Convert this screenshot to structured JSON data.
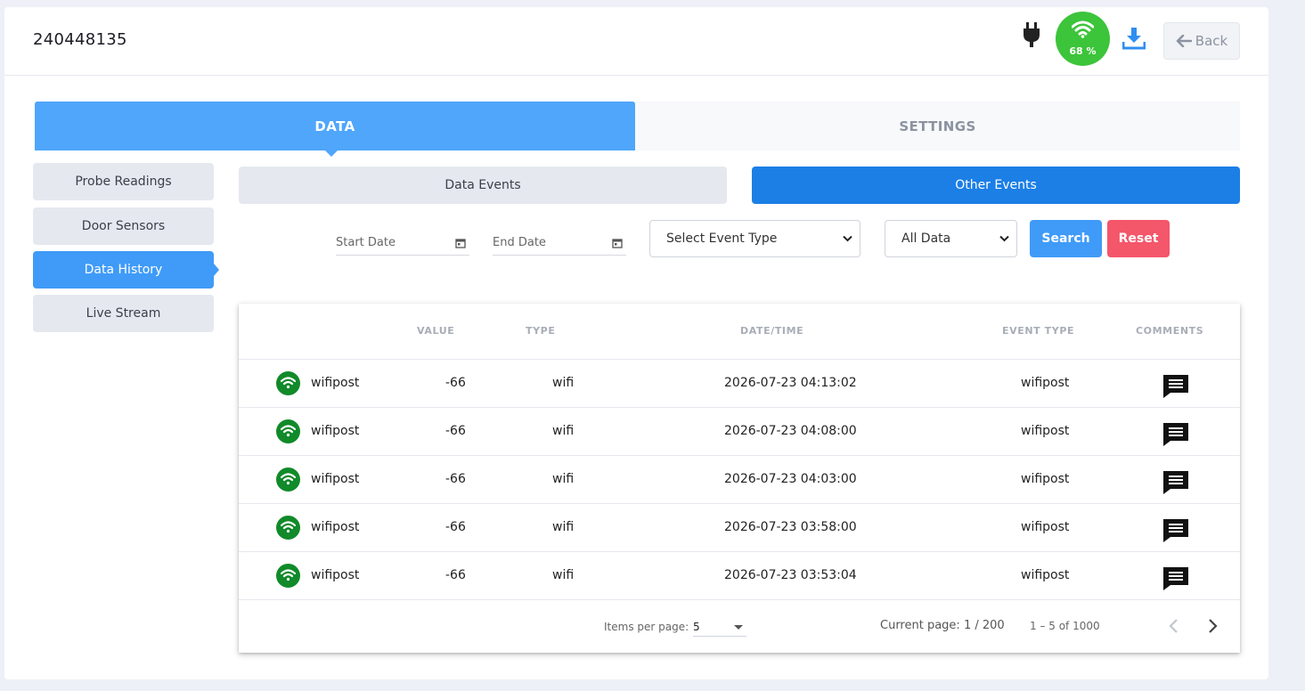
{
  "header": {
    "device_id": "240448135",
    "wifi_percent": "68 %",
    "back_label": "Back"
  },
  "main_tabs": [
    {
      "label": "DATA",
      "active": true
    },
    {
      "label": "SETTINGS",
      "active": false
    }
  ],
  "sidebar": {
    "items": [
      {
        "label": "Probe Readings",
        "active": false
      },
      {
        "label": "Door Sensors",
        "active": false
      },
      {
        "label": "Data History",
        "active": true
      },
      {
        "label": "Live Stream",
        "active": false
      }
    ]
  },
  "sub_tabs": [
    {
      "label": "Data Events",
      "active": false
    },
    {
      "label": "Other Events",
      "active": true
    }
  ],
  "filters": {
    "start_date_placeholder": "Start Date",
    "end_date_placeholder": "End Date",
    "event_type_selected": "Select Event Type",
    "data_filter_selected": "All Data",
    "search_label": "Search",
    "reset_label": "Reset"
  },
  "table": {
    "columns": [
      "VALUE",
      "TYPE",
      "DATE/TIME",
      "EVENT TYPE",
      "COMMENTS"
    ],
    "rows": [
      {
        "name": "wifipost",
        "value": "-66",
        "type": "wifi",
        "datetime": "2026-07-23 04:13:02",
        "event_type": "wifipost"
      },
      {
        "name": "wifipost",
        "value": "-66",
        "type": "wifi",
        "datetime": "2026-07-23 04:08:00",
        "event_type": "wifipost"
      },
      {
        "name": "wifipost",
        "value": "-66",
        "type": "wifi",
        "datetime": "2026-07-23 04:03:00",
        "event_type": "wifipost"
      },
      {
        "name": "wifipost",
        "value": "-66",
        "type": "wifi",
        "datetime": "2026-07-23 03:58:00",
        "event_type": "wifipost"
      },
      {
        "name": "wifipost",
        "value": "-66",
        "type": "wifi",
        "datetime": "2026-07-23 03:53:04",
        "event_type": "wifipost"
      }
    ]
  },
  "pagination": {
    "items_per_page_label": "Items per page:",
    "items_per_page_value": "5",
    "current_page": "Current page: 1 / 200",
    "range": "1 – 5 of 1000"
  },
  "colors": {
    "primary": "#3f9bf7",
    "active_subtab": "#1b7fe6",
    "wifi_badge": "#3cc43a",
    "reset": "#f4566a",
    "wifi_row_icon": "#118a2a"
  },
  "icons": {
    "power": "plug-icon",
    "signal": "wifi-icon",
    "download": "download-icon",
    "back": "arrow-left-icon",
    "calendar": "calendar-icon",
    "comment": "comment-icon",
    "prev": "chevron-left-icon",
    "next": "chevron-right-icon"
  }
}
